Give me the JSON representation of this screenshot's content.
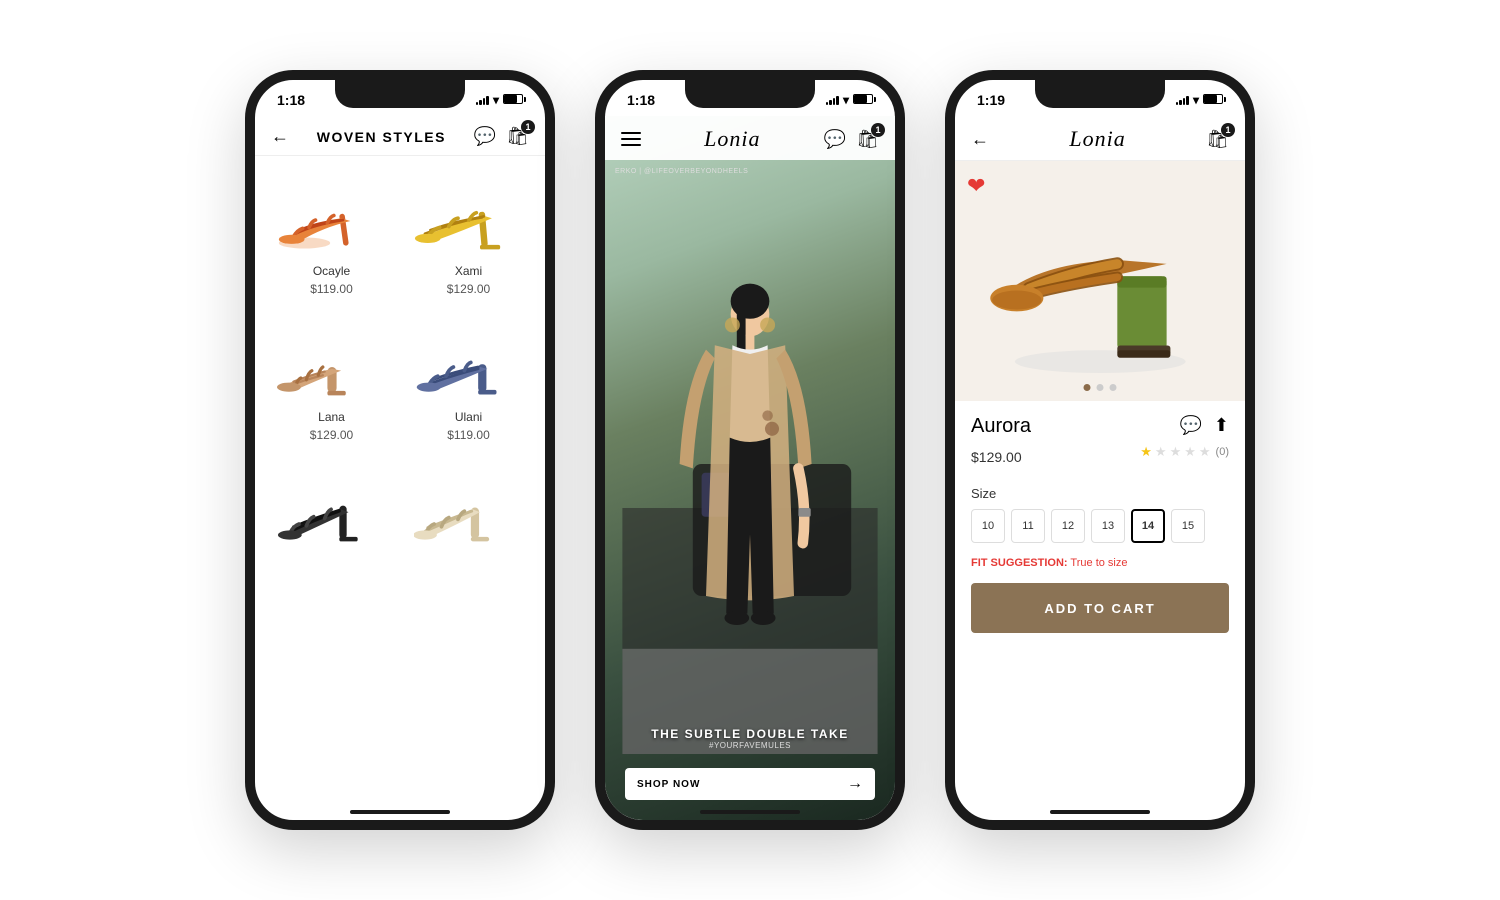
{
  "phones": {
    "phone1": {
      "time": "1:18",
      "title": "WOVEN STYLES",
      "cart_count": "1",
      "products": [
        {
          "name": "Ocayle",
          "price": "$119.00",
          "color": "orange"
        },
        {
          "name": "Xami",
          "price": "$129.00",
          "color": "yellow"
        },
        {
          "name": "Lana",
          "price": "$129.00",
          "color": "tan"
        },
        {
          "name": "Ulani",
          "price": "$119.00",
          "color": "blue"
        },
        {
          "name": "",
          "price": "",
          "color": "black"
        },
        {
          "name": "",
          "price": "",
          "color": "cream"
        }
      ]
    },
    "phone2": {
      "time": "1:18",
      "brand": "Lonia",
      "cart_count": "1",
      "photo_credit": "ERKO | @LIFEOVERBEYONDHEELS",
      "caption_title": "THE SUBTLE DOUBLE TAKE",
      "caption_hashtag": "#YOURFAVEMULES",
      "shop_now": "SHOP NOW"
    },
    "phone3": {
      "time": "1:19",
      "brand": "Lonia",
      "cart_count": "1",
      "product": {
        "name": "Aurora",
        "price": "$129.00",
        "review_count": "(0)",
        "fit_label": "FIT SUGGESTION:",
        "fit_value": "True to size",
        "sizes": [
          "10",
          "11",
          "12",
          "13",
          "14",
          "15"
        ],
        "selected_size": "14",
        "add_to_cart": "ADD TO CART"
      },
      "carousel_dots": 3,
      "active_dot": 0
    }
  }
}
